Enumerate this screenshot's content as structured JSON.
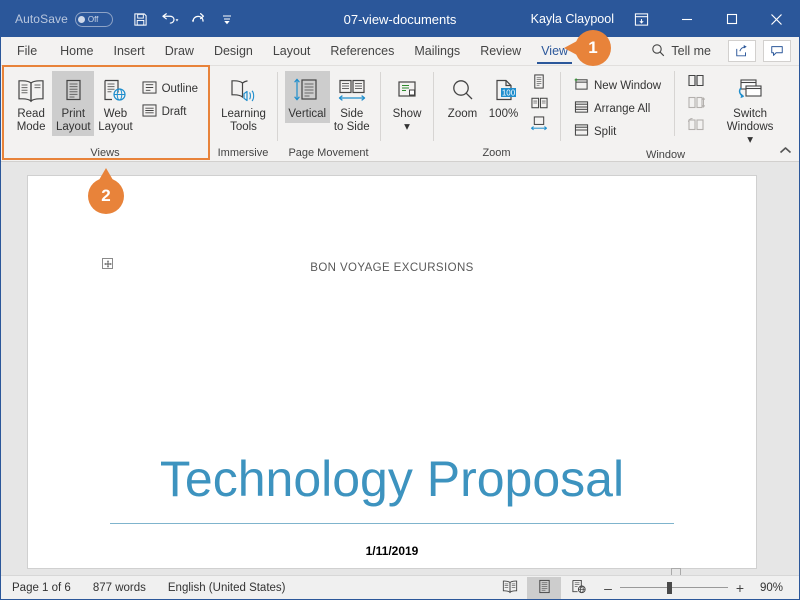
{
  "titlebar": {
    "autosave_label": "AutoSave",
    "autosave_state": "Off",
    "save_icon": "save-icon",
    "undo_icon": "undo-icon",
    "redo_icon": "redo-icon",
    "customize_icon": "customize-quick-access-toolbar-icon",
    "document_title": "07-view-documents",
    "user_name": "Kayla Claypool",
    "ribbon_display_icon": "ribbon-display-options-icon",
    "minimize": "–",
    "restore": "❐",
    "close": "✕"
  },
  "tabs": [
    {
      "label": "File",
      "active": false
    },
    {
      "label": "Home",
      "active": false
    },
    {
      "label": "Insert",
      "active": false
    },
    {
      "label": "Draw",
      "active": false
    },
    {
      "label": "Design",
      "active": false
    },
    {
      "label": "Layout",
      "active": false
    },
    {
      "label": "References",
      "active": false
    },
    {
      "label": "Mailings",
      "active": false
    },
    {
      "label": "Review",
      "active": false
    },
    {
      "label": "View",
      "active": true
    }
  ],
  "tab_right": {
    "search_icon": "search-icon",
    "tell_me": "Tell me",
    "share_icon": "share-icon",
    "comments_icon": "comments-icon"
  },
  "ribbon": {
    "collapse_icon": "collapse-ribbon-icon",
    "groups": [
      {
        "name": "views",
        "label": "Views",
        "big_buttons": [
          {
            "caption_line1": "Read",
            "caption_line2": "Mode",
            "icon": "read-mode-icon",
            "selected": false
          },
          {
            "caption_line1": "Print",
            "caption_line2": "Layout",
            "icon": "print-layout-icon",
            "selected": true
          },
          {
            "caption_line1": "Web",
            "caption_line2": "Layout",
            "icon": "web-layout-icon",
            "selected": false
          }
        ],
        "small_buttons": [
          {
            "label": "Outline",
            "icon": "outline-view-icon"
          },
          {
            "label": "Draft",
            "icon": "draft-view-icon"
          }
        ]
      },
      {
        "name": "immersive",
        "label": "Immersive",
        "big_buttons": [
          {
            "caption_line1": "Learning",
            "caption_line2": "Tools",
            "icon": "learning-tools-icon",
            "selected": false
          }
        ]
      },
      {
        "name": "page-movement",
        "label": "Page Movement",
        "big_buttons": [
          {
            "caption_line1": "Vertical",
            "caption_line2": "",
            "icon": "vertical-page-movement-icon",
            "selected": true
          },
          {
            "caption_line1": "Side",
            "caption_line2": "to Side",
            "icon": "side-to-side-icon",
            "selected": false
          }
        ]
      },
      {
        "name": "show",
        "label": "",
        "big_buttons": [
          {
            "caption_line1": "Show",
            "caption_line2": "▾",
            "icon": "show-icon",
            "selected": false
          }
        ]
      },
      {
        "name": "zoom",
        "label": "Zoom",
        "big_buttons": [
          {
            "caption_line1": "Zoom",
            "caption_line2": "",
            "icon": "zoom-icon",
            "selected": false
          },
          {
            "caption_line1": "100%",
            "caption_line2": "",
            "icon": "zoom-100-percent-icon",
            "selected": false
          }
        ],
        "icon_buttons": [
          {
            "icon": "one-page-icon"
          },
          {
            "icon": "multiple-pages-icon"
          },
          {
            "icon": "page-width-icon"
          }
        ]
      },
      {
        "name": "window",
        "label": "Window",
        "small_buttons": [
          {
            "label": "New Window",
            "icon": "new-window-icon",
            "disabled": false
          },
          {
            "label": "Arrange All",
            "icon": "arrange-all-icon",
            "disabled": false
          },
          {
            "label": "Split",
            "icon": "split-icon",
            "disabled": false
          }
        ],
        "icon_buttons": [
          {
            "icon": "view-side-by-side-icon",
            "disabled": false
          },
          {
            "icon": "synchronous-scrolling-icon",
            "disabled": true
          },
          {
            "icon": "reset-window-position-icon",
            "disabled": true
          }
        ],
        "big_buttons": [
          {
            "caption_line1": "Switch",
            "caption_line2": "Windows ▾",
            "icon": "switch-windows-icon",
            "selected": false
          }
        ]
      }
    ]
  },
  "document": {
    "header_text": "BON VOYAGE EXCURSIONS",
    "title": "Technology Proposal",
    "date": "1/11/2019",
    "anchor_icon": "move-handle-icon",
    "title_color": "#3d93bf"
  },
  "statusbar": {
    "page": "Page 1 of 6",
    "words": "877 words",
    "language": "English (United States)",
    "view_buttons": [
      {
        "icon": "read-mode-view-icon",
        "selected": false
      },
      {
        "icon": "print-layout-view-icon",
        "selected": true
      },
      {
        "icon": "web-layout-view-icon",
        "selected": false
      }
    ],
    "zoom_out": "–",
    "zoom_in": "+",
    "zoom_level": "90%"
  },
  "callouts": [
    {
      "number": "1",
      "direction": "left-tail"
    },
    {
      "number": "2",
      "direction": "up-tail"
    }
  ],
  "colors": {
    "accent": "#e8833a",
    "word_blue": "#2b579a",
    "ribbon_bg": "#f3f2f1"
  }
}
